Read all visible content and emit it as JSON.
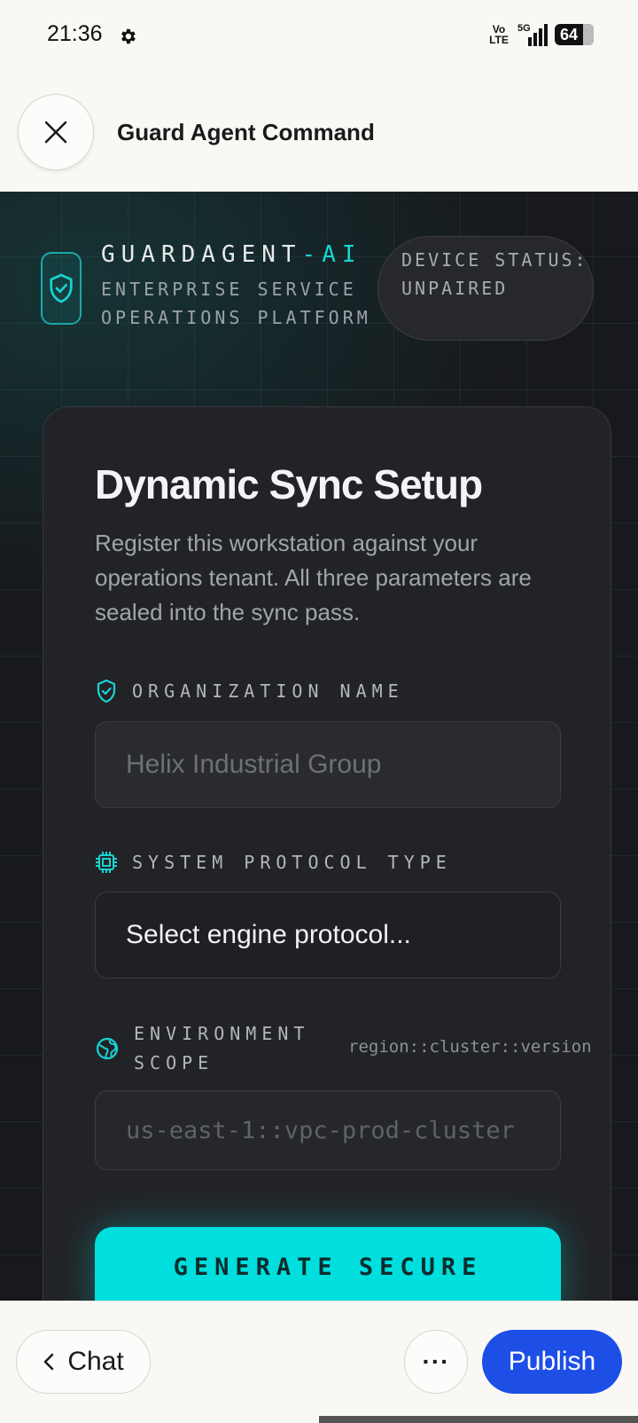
{
  "status_bar": {
    "time": "21:36",
    "volte": "Vo\nLTE",
    "network": "5G",
    "battery": "64"
  },
  "header": {
    "title": "Guard Agent Command",
    "close_icon": "close-icon"
  },
  "brand": {
    "name_main": "GUARDAGENT",
    "name_accent": "-AI",
    "subtitle": "ENTERPRISE SERVICE OPERATIONS PLATFORM",
    "device_status": "DEVICE STATUS: UNPAIRED"
  },
  "card": {
    "title": "Dynamic Sync Setup",
    "description": "Register this workstation against your operations tenant. All three parameters are sealed into the sync pass.",
    "org_label": "ORGANIZATION NAME",
    "org_placeholder": "Helix Industrial Group",
    "protocol_label": "SYSTEM PROTOCOL TYPE",
    "protocol_value": "Select engine protocol...",
    "env_label": "ENVIRONMENT SCOPE",
    "env_hint": "region::cluster::version",
    "env_placeholder": "us-east-1::vpc-prod-cluster",
    "generate_label": "GENERATE SECURE"
  },
  "bottom_bar": {
    "chat_label": "Chat",
    "more_label": "···",
    "publish_label": "Publish"
  },
  "colors": {
    "accent": "#00dede",
    "publish": "#1d4ee6",
    "background_dark": "#17191c"
  }
}
